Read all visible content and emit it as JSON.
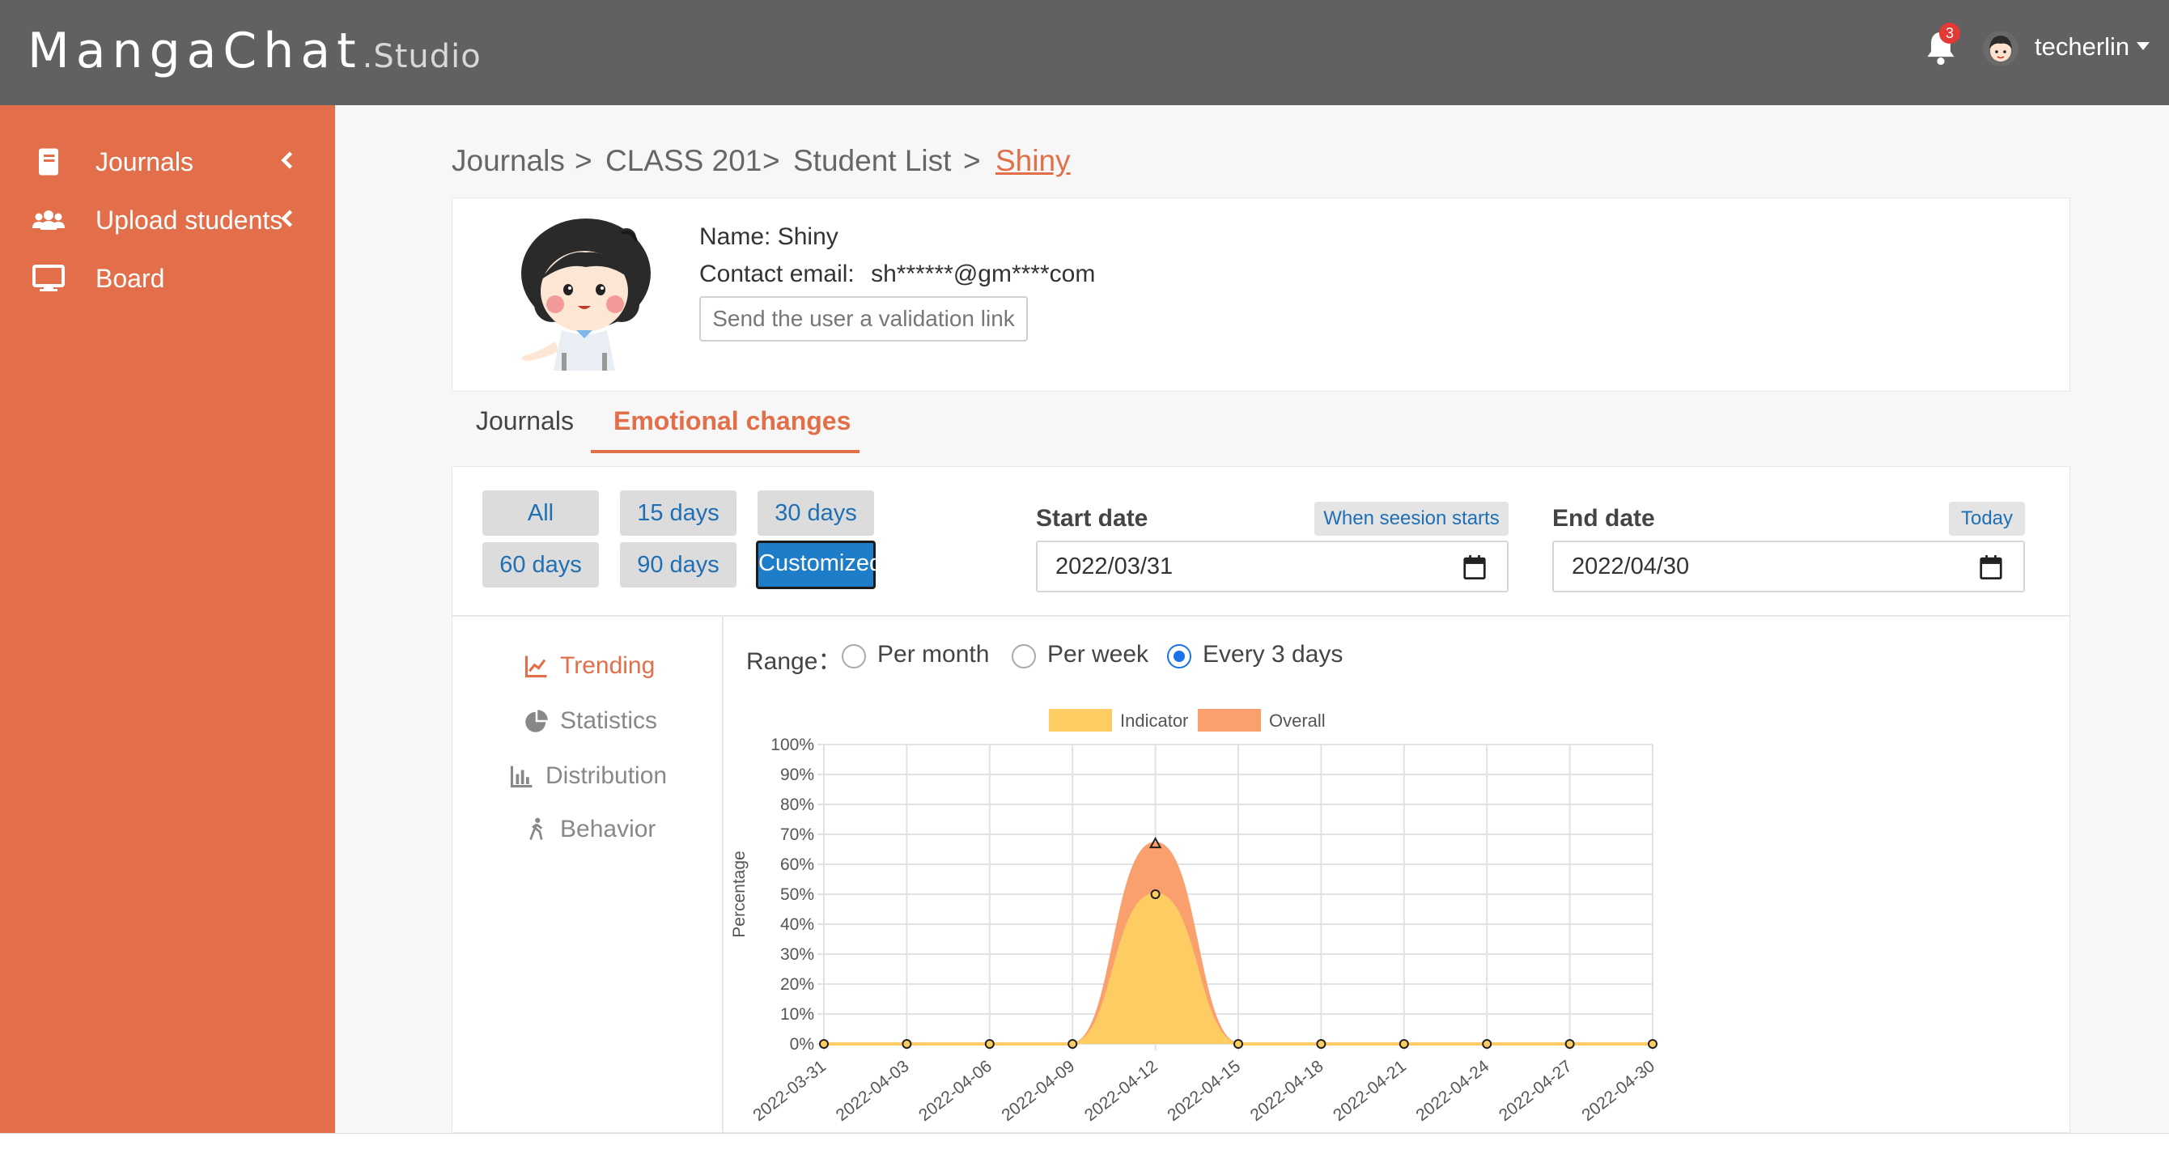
{
  "header": {
    "brand_main": "MangaChat",
    "brand_suffix": ".Studio",
    "notification_count": "3",
    "username": "techerlin"
  },
  "sidebar": {
    "items": [
      {
        "label": "Journals",
        "icon": "book-icon"
      },
      {
        "label": "Upload students",
        "icon": "users-icon"
      },
      {
        "label": "Board",
        "icon": "monitor-icon"
      }
    ]
  },
  "breadcrumb": {
    "items": [
      "Journals",
      "CLASS 201",
      "Student List",
      "Shiny"
    ],
    "separator": ">"
  },
  "profile": {
    "name_label": "Name:",
    "name_value": "Shiny",
    "email_label": "Contact email:",
    "email_value": "sh******@gm****com",
    "validate_button": "Send the user a validation link"
  },
  "tabs": [
    {
      "label": "Journals",
      "active": false
    },
    {
      "label": "Emotional changes",
      "active": true
    }
  ],
  "filters": {
    "buttons": [
      "All",
      "15 days",
      "30 days",
      "60 days",
      "90 days",
      "Customized"
    ],
    "selected": "Customized",
    "start_label": "Start date",
    "start_chip": "When seesion starts",
    "start_value": "2022/03/31",
    "end_label": "End date",
    "end_chip": "Today",
    "end_value": "2022/04/30"
  },
  "left_menu": [
    {
      "label": "Trending",
      "icon": "line-chart-icon",
      "active": true
    },
    {
      "label": "Statistics",
      "icon": "pie-chart-icon",
      "active": false
    },
    {
      "label": "Distribution",
      "icon": "bar-chart-icon",
      "active": false
    },
    {
      "label": "Behavior",
      "icon": "walking-icon",
      "active": false
    }
  ],
  "range": {
    "label": "Range：",
    "options": [
      "Per month",
      "Per week",
      "Every 3 days"
    ],
    "selected": "Every 3 days"
  },
  "colors": {
    "accent": "#e26e4a",
    "topbar": "#616161",
    "indicator": "#fdcc62",
    "overall": "#f9a06e",
    "link_blue": "#1f6fb5"
  },
  "chart_data": {
    "type": "area",
    "ylabel": "Percentage",
    "ylim": [
      0,
      100
    ],
    "yticks": [
      "0%",
      "10%",
      "20%",
      "30%",
      "40%",
      "50%",
      "60%",
      "70%",
      "80%",
      "90%",
      "100%"
    ],
    "grid": true,
    "legend_position": "top",
    "x": [
      "2022-03-31",
      "2022-04-03",
      "2022-04-06",
      "2022-04-09",
      "2022-04-12",
      "2022-04-15",
      "2022-04-18",
      "2022-04-21",
      "2022-04-24",
      "2022-04-27",
      "2022-04-30"
    ],
    "series": [
      {
        "name": "Indicator",
        "color": "#fdcc62",
        "values": [
          0,
          0,
          0,
          0,
          50,
          0,
          0,
          0,
          0,
          0,
          0
        ]
      },
      {
        "name": "Overall",
        "color": "#f9a06e",
        "values": [
          0,
          0,
          0,
          0,
          67,
          0,
          0,
          0,
          0,
          0,
          0
        ]
      }
    ]
  }
}
